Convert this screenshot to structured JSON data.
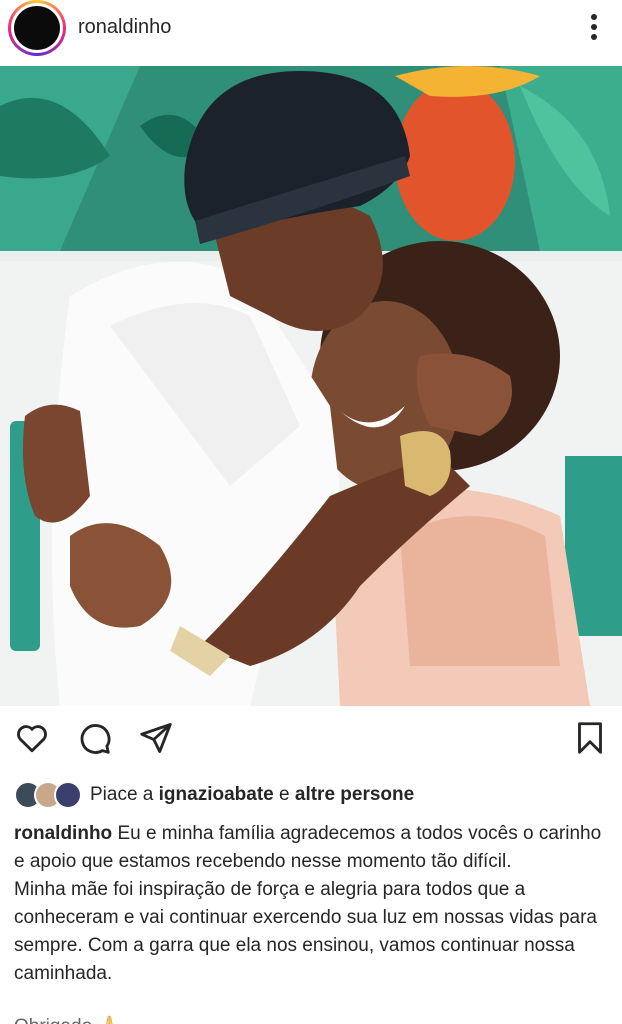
{
  "post": {
    "username": "ronaldinho",
    "likes": {
      "prefix": "Piace a",
      "user": "ignazioabate",
      "connector": "e",
      "others": "altre persone"
    },
    "caption": {
      "user": "ronaldinho",
      "line1": "Eu e minha família agradecemos a todos vocês o carinho e apoio que estamos recebendo nesse momento tão difícil.",
      "line2": "Minha mãe foi inspiração de força e alegria para todos que a conheceram e vai continuar exercendo sua luz em nossas vidas para sempre. Com a garra que ela nos ensinou, vamos continuar nossa caminhada.",
      "truncated": "Obrigado 🙏"
    }
  },
  "icons": [
    "more-options-icon",
    "heart-icon",
    "comment-icon",
    "share-icon",
    "bookmark-icon"
  ],
  "colors": {
    "text": "#262626",
    "background": "#ffffff",
    "photo_leaf": "#2e9e8a",
    "photo_orange": "#e25a2a"
  }
}
